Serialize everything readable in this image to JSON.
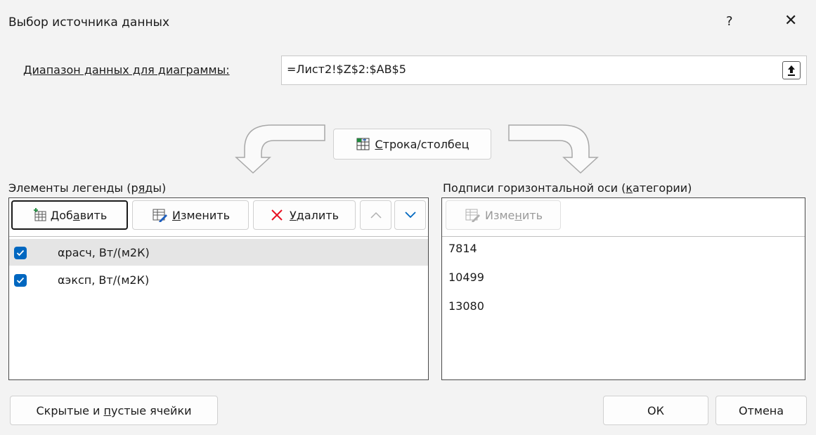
{
  "dialog": {
    "title": "Выбор источника данных",
    "help_label": "?",
    "close_label": "✕"
  },
  "range": {
    "label": "Диапазон данных для диаграммы:",
    "value": "=Лист2!$Z$2:$AB$5"
  },
  "switch_button": {
    "prefix": "",
    "underlined": "С",
    "rest": "трока/столбец"
  },
  "legend": {
    "heading_pre": "Элементы легенды (р",
    "heading_u": "я",
    "heading_post": "ды)",
    "add_pre": "Доб",
    "add_u": "а",
    "add_post": "вить",
    "edit_u": "И",
    "edit_post": "зменить",
    "delete_u": "У",
    "delete_post": "далить",
    "series": [
      {
        "label": "αрасч, Вт/(м2К)",
        "checked": true
      },
      {
        "label": "αэксп, Вт/(м2К)",
        "checked": true
      }
    ]
  },
  "axis": {
    "heading_pre": "Подписи горизонтальной оси (",
    "heading_u": "к",
    "heading_post": "атегории)",
    "edit_pre": "Изме",
    "edit_u": "н",
    "edit_post": "ить",
    "categories": [
      "7814",
      "10499",
      "13080"
    ]
  },
  "footer": {
    "hidden_pre": "Скрытые и ",
    "hidden_u": "п",
    "hidden_post": "устые ячейки",
    "ok_label": "ОК",
    "cancel_label": "Отмена"
  },
  "colors": {
    "accent": "#0067c0",
    "selected_row": "#e5e5e5",
    "delete_x": "#e81123"
  },
  "icons": [
    "collapse-dialog-icon",
    "switch-row-column-icon",
    "add-table-icon",
    "edit-table-icon",
    "delete-x-icon",
    "move-up-icon",
    "move-down-icon",
    "checkbox-checked-icon"
  ]
}
